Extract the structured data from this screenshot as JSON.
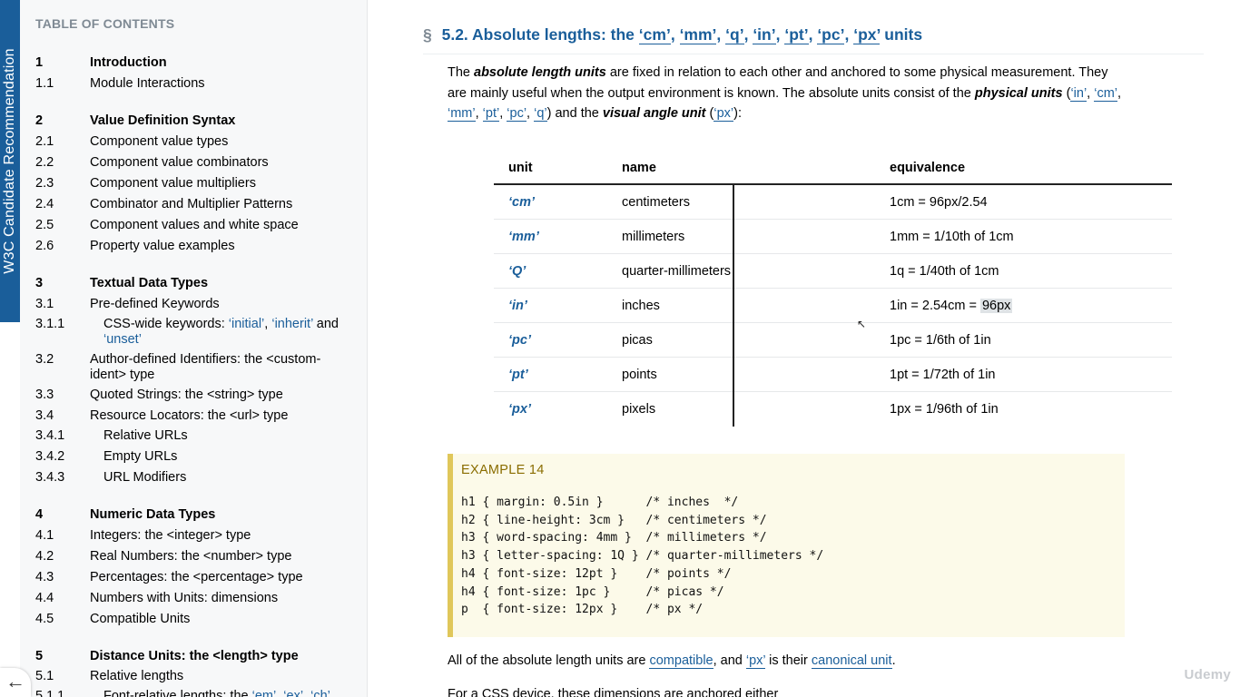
{
  "status_tab": "W3C Candidate Recommendation",
  "toc": {
    "title": "TABLE OF CONTENTS",
    "items": [
      {
        "num": "1",
        "text": "Introduction",
        "heading": true
      },
      {
        "num": "1.1",
        "text": "Module Interactions"
      },
      {
        "num": "2",
        "text": "Value Definition Syntax",
        "heading": true
      },
      {
        "num": "2.1",
        "text": "Component value types"
      },
      {
        "num": "2.2",
        "text": "Component value combinators"
      },
      {
        "num": "2.3",
        "text": "Component value multipliers"
      },
      {
        "num": "2.4",
        "text": "Combinator and Multiplier Patterns"
      },
      {
        "num": "2.5",
        "text": "Component values and white space"
      },
      {
        "num": "2.6",
        "text": "Property value examples"
      },
      {
        "num": "3",
        "text": "Textual Data Types",
        "heading": true
      },
      {
        "num": "3.1",
        "text": "Pre-defined Keywords"
      },
      {
        "num": "3.1.1",
        "text_prefix": "CSS-wide keywords: ",
        "link1": "‘initial’",
        "sep1": ", ",
        "link2": "‘inherit’",
        "sep2": " and ",
        "link3": "‘unset’",
        "sub": true
      },
      {
        "num": "3.2",
        "text": "Author-defined Identifiers: the <custom-ident> type"
      },
      {
        "num": "3.3",
        "text": "Quoted Strings: the <string> type"
      },
      {
        "num": "3.4",
        "text": "Resource Locators: the <url> type"
      },
      {
        "num": "3.4.1",
        "text": "Relative URLs",
        "sub": true
      },
      {
        "num": "3.4.2",
        "text": "Empty URLs",
        "sub": true
      },
      {
        "num": "3.4.3",
        "text": "URL Modifiers",
        "sub": true
      },
      {
        "num": "4",
        "text": "Numeric Data Types",
        "heading": true
      },
      {
        "num": "4.1",
        "text": "Integers: the <integer> type"
      },
      {
        "num": "4.2",
        "text": "Real Numbers: the <number> type"
      },
      {
        "num": "4.3",
        "text": "Percentages: the <percentage> type"
      },
      {
        "num": "4.4",
        "text": "Numbers with Units: dimensions"
      },
      {
        "num": "4.5",
        "text": "Compatible Units"
      },
      {
        "num": "5",
        "text": "Distance Units: the <length> type",
        "heading": true
      },
      {
        "num": "5.1",
        "text": "Relative lengths"
      },
      {
        "num": "5.1.1",
        "text_prefix": "Font-relative lengths: the ",
        "link1": "‘em’",
        "sep1": ", ",
        "link2": "‘ex’",
        "sep2": ", ",
        "link3": "‘ch’",
        "sub": true
      }
    ]
  },
  "back_icon": "left-arrow-icon",
  "section": {
    "sec_mark": "§",
    "number": "5.2.",
    "title_prefix": "Absolute lengths: the",
    "units": [
      "‘cm’",
      "‘mm’",
      "‘q’",
      "‘in’",
      "‘pt’",
      "‘pc’",
      "‘px’"
    ],
    "title_suffix": "units"
  },
  "intro": {
    "p1": "The ",
    "term1": "absolute length units",
    "p2": " are fixed in relation to each other and anchored to some physical measurement. They are mainly useful when the output environment is known. The absolute units consist of the ",
    "term2": "physical units",
    "p3": " (",
    "unit_links": [
      "‘in’",
      "‘cm’",
      "‘mm’",
      "‘pt’",
      "‘pc’",
      "‘q’"
    ],
    "p4": ") and the ",
    "term3": "visual angle unit",
    "p5": " (",
    "px_link": "‘px’",
    "p6": "):"
  },
  "table": {
    "headers": [
      "unit",
      "name",
      "equivalence"
    ],
    "rows": [
      {
        "unit": "‘cm’",
        "name": "centimeters",
        "equiv": "1cm = 96px/2.54"
      },
      {
        "unit": "‘mm’",
        "name": "millimeters",
        "equiv": "1mm = 1/10th of 1cm"
      },
      {
        "unit": "‘Q’",
        "name": "quarter-millimeters",
        "equiv": "1q = 1/40th of 1cm"
      },
      {
        "unit": "‘in’",
        "name": "inches",
        "equiv_prefix": "1in = 2.54cm = ",
        "equiv_hl": "96px"
      },
      {
        "unit": "‘pc’",
        "name": "picas",
        "equiv": "1pc = 1/6th of 1in"
      },
      {
        "unit": "‘pt’",
        "name": "points",
        "equiv": "1pt = 1/72th of 1in"
      },
      {
        "unit": "‘px’",
        "name": "pixels",
        "equiv": "1px = 1/96th of 1in"
      }
    ]
  },
  "example": {
    "title": "EXAMPLE 14",
    "code": "h1 { margin: 0.5in }      /* inches  */\nh2 { line-height: 3cm }   /* centimeters */\nh3 { word-spacing: 4mm }  /* millimeters */\nh3 { letter-spacing: 1Q } /* quarter-millimeters */\nh4 { font-size: 12pt }    /* points */\nh4 { font-size: 1pc }     /* picas */\np  { font-size: 12px }    /* px */"
  },
  "compat": {
    "p1": "All of the absolute length units are ",
    "link1": "compatible",
    "p2": ", and ",
    "link2": "‘px’",
    "p3": " is their ",
    "link3": "canonical unit",
    "p4": "."
  },
  "trailing": "For a CSS device, these dimensions are anchored either",
  "watermark": "Udemy"
}
